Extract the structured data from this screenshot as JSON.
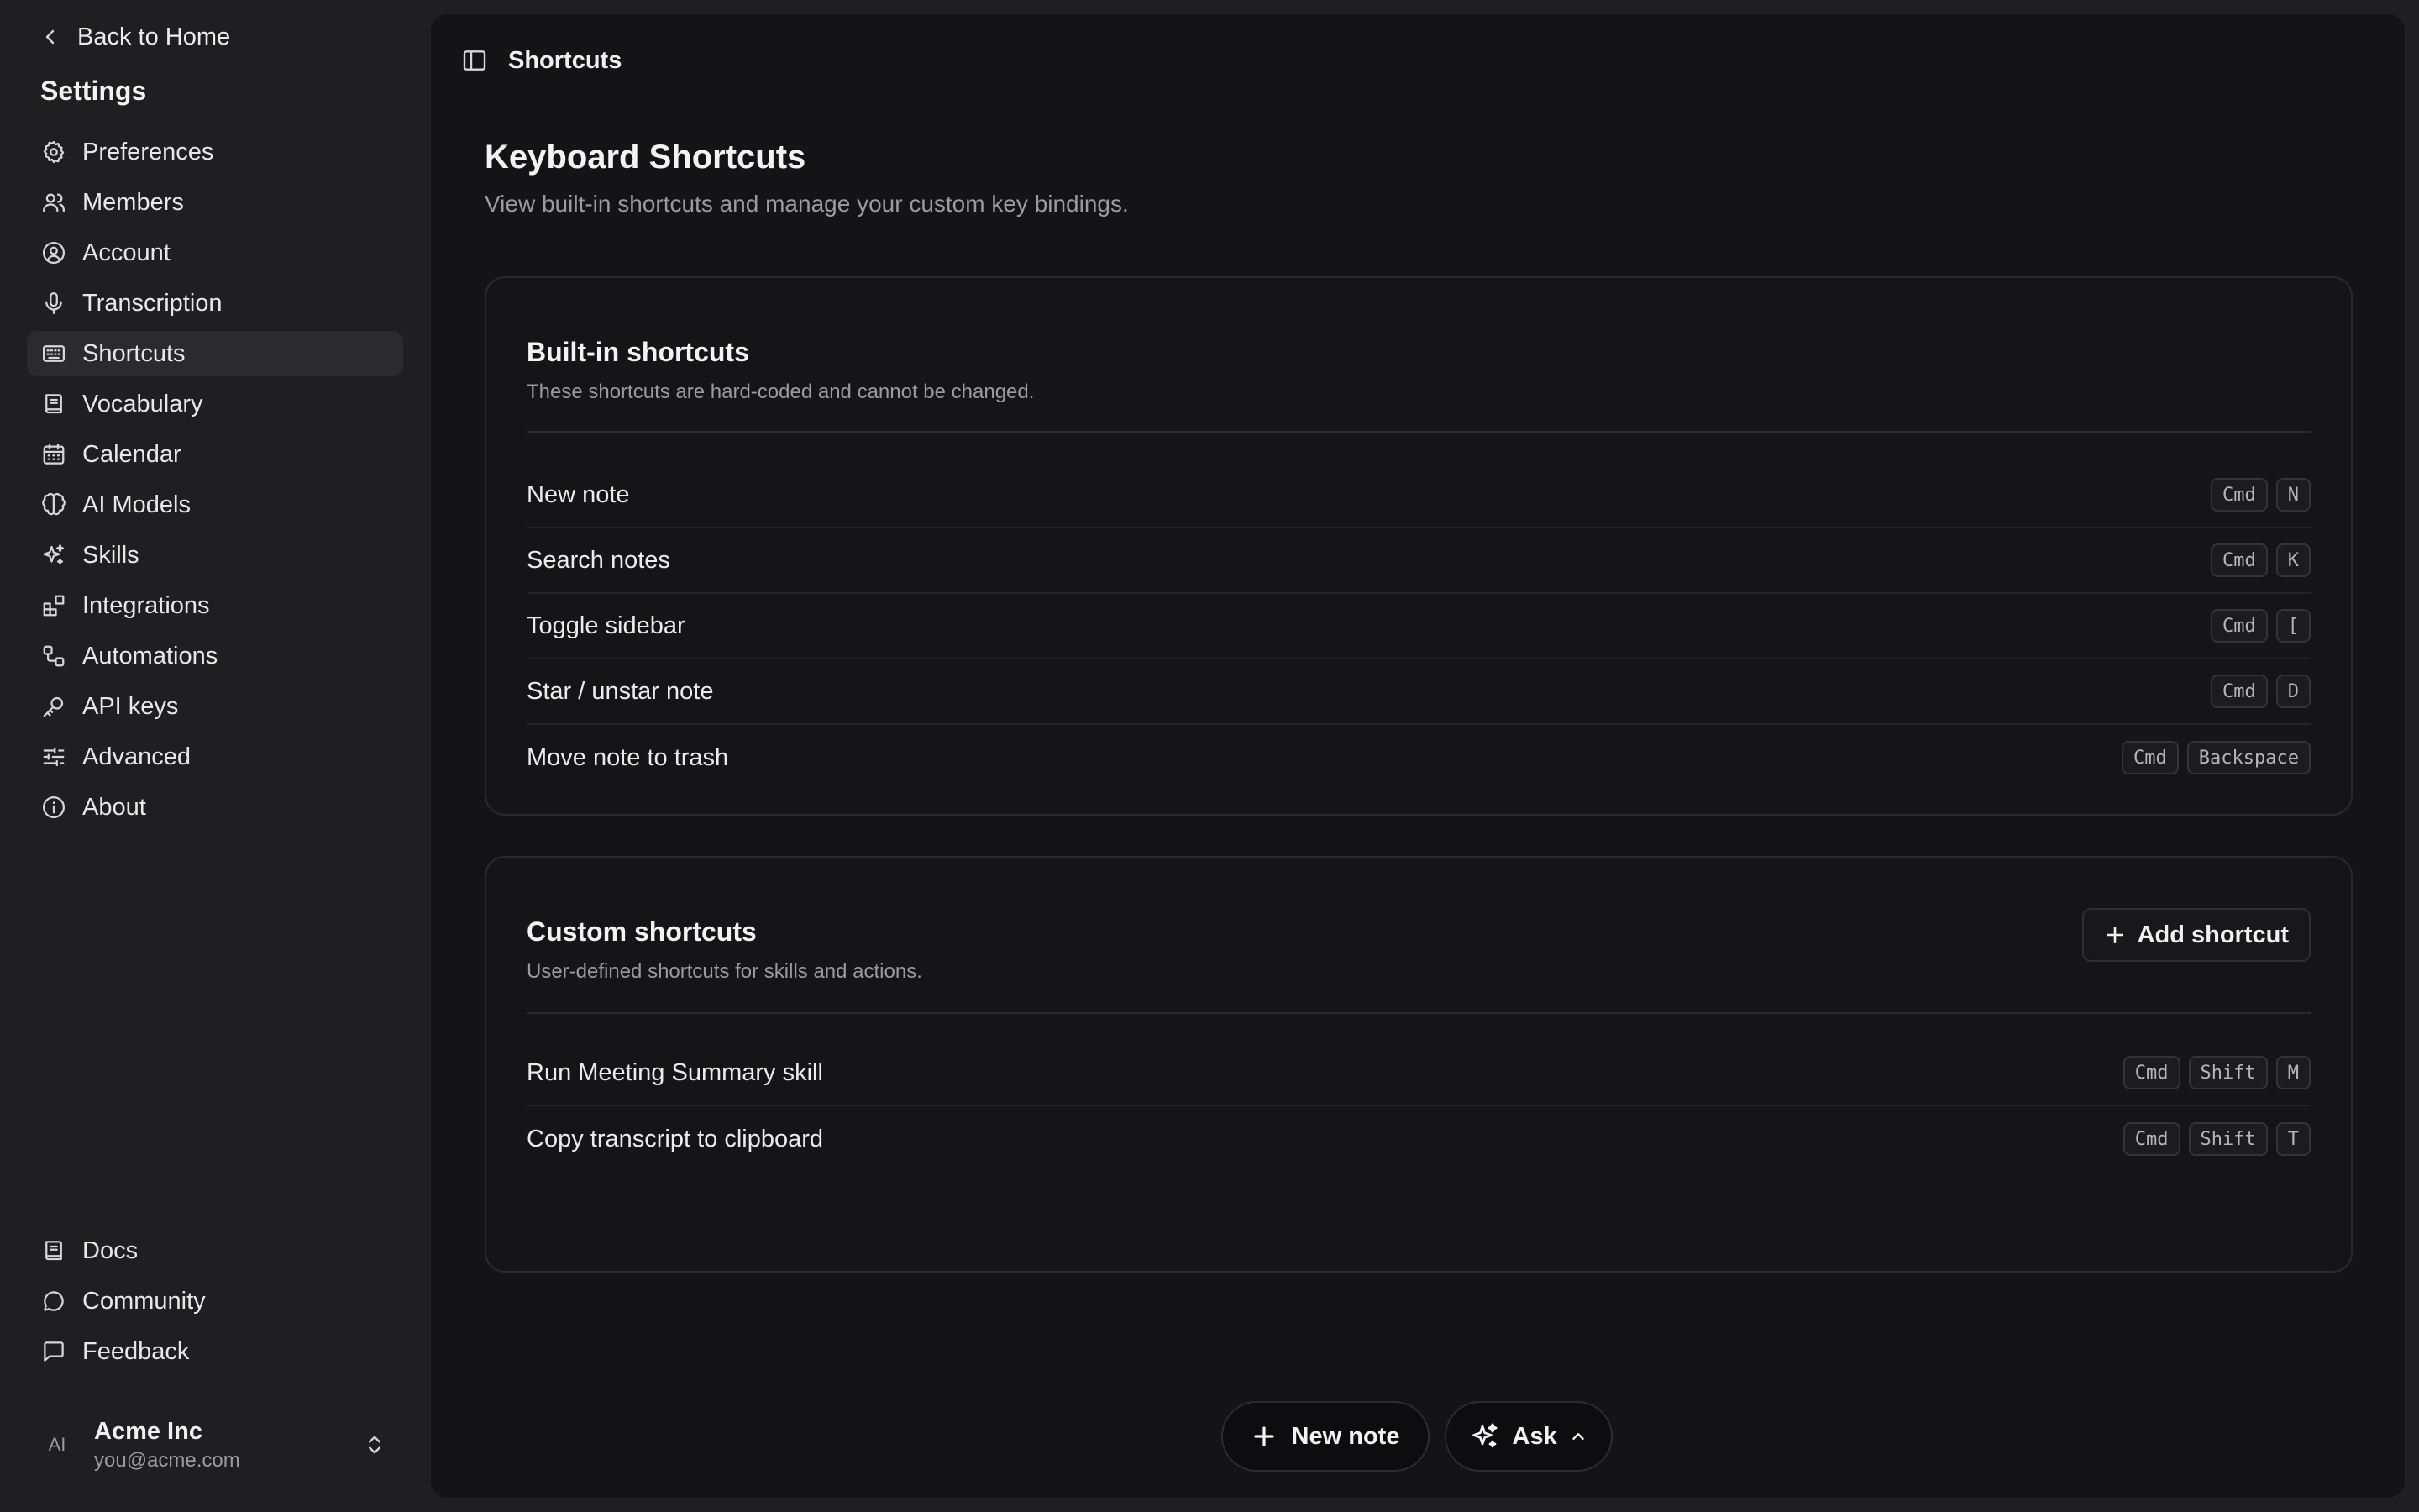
{
  "sidebar": {
    "back_label": "Back to Home",
    "title": "Settings",
    "items": [
      {
        "label": "Preferences",
        "icon": "gear-icon"
      },
      {
        "label": "Members",
        "icon": "users-icon"
      },
      {
        "label": "Account",
        "icon": "user-circle-icon"
      },
      {
        "label": "Transcription",
        "icon": "microphone-icon"
      },
      {
        "label": "Shortcuts",
        "icon": "keyboard-icon",
        "active": true
      },
      {
        "label": "Vocabulary",
        "icon": "book-icon"
      },
      {
        "label": "Calendar",
        "icon": "calendar-icon"
      },
      {
        "label": "AI Models",
        "icon": "brain-icon"
      },
      {
        "label": "Skills",
        "icon": "sparkles-icon"
      },
      {
        "label": "Integrations",
        "icon": "blocks-icon"
      },
      {
        "label": "Automations",
        "icon": "workflow-icon"
      },
      {
        "label": "API keys",
        "icon": "key-icon"
      },
      {
        "label": "Advanced",
        "icon": "sliders-icon"
      },
      {
        "label": "About",
        "icon": "info-icon"
      }
    ],
    "bottom_items": [
      {
        "label": "Docs",
        "icon": "book-icon"
      },
      {
        "label": "Community",
        "icon": "chat-bubble-icon"
      },
      {
        "label": "Feedback",
        "icon": "message-square-icon"
      }
    ],
    "user": {
      "initials": "AI",
      "name": "Acme Inc",
      "email": "you@acme.com"
    }
  },
  "header": {
    "breadcrumb": "Shortcuts"
  },
  "page": {
    "title": "Keyboard Shortcuts",
    "subtitle": "View built-in shortcuts and manage your custom key bindings."
  },
  "builtin": {
    "title": "Built-in shortcuts",
    "subtitle": "These shortcuts are hard-coded and cannot be changed.",
    "rows": [
      {
        "label": "New note",
        "keys": [
          "Cmd",
          "N"
        ]
      },
      {
        "label": "Search notes",
        "keys": [
          "Cmd",
          "K"
        ]
      },
      {
        "label": "Toggle sidebar",
        "keys": [
          "Cmd",
          "["
        ]
      },
      {
        "label": "Star / unstar note",
        "keys": [
          "Cmd",
          "D"
        ]
      },
      {
        "label": "Move note to trash",
        "keys": [
          "Cmd",
          "Backspace"
        ]
      }
    ]
  },
  "custom": {
    "title": "Custom shortcuts",
    "subtitle": "User-defined shortcuts for skills and actions.",
    "add_label": "Add shortcut",
    "rows": [
      {
        "label": "Run Meeting Summary skill",
        "keys": [
          "Cmd",
          "Shift",
          "M"
        ]
      },
      {
        "label": "Copy transcript to clipboard",
        "keys": [
          "Cmd",
          "Shift",
          "T"
        ]
      }
    ]
  },
  "footer": {
    "new_note_label": "New note",
    "ask_label": "Ask"
  }
}
